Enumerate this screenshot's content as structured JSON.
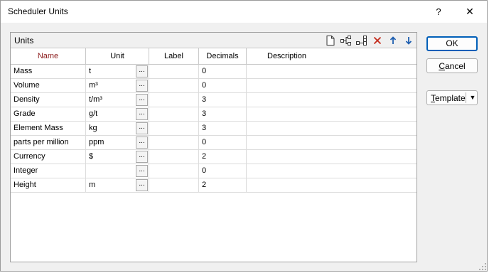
{
  "window": {
    "title": "Scheduler Units",
    "help_label": "?",
    "close_label": "✕"
  },
  "panel": {
    "title": "Units",
    "toolbar_icons": [
      "new-document-icon",
      "insert-row-icon",
      "append-row-icon",
      "delete-icon",
      "move-up-icon",
      "move-down-icon"
    ]
  },
  "table": {
    "columns": [
      "Name",
      "Unit",
      "Label",
      "Decimals",
      "Description"
    ],
    "rows": [
      {
        "name": "Mass",
        "unit": "t",
        "label": "",
        "decimals": "0",
        "description": ""
      },
      {
        "name": "Volume",
        "unit": "m³",
        "label": "",
        "decimals": "0",
        "description": ""
      },
      {
        "name": "Density",
        "unit": "t/m³",
        "label": "",
        "decimals": "3",
        "description": ""
      },
      {
        "name": "Grade",
        "unit": "g/t",
        "label": "",
        "decimals": "3",
        "description": ""
      },
      {
        "name": "Element Mass",
        "unit": "kg",
        "label": "",
        "decimals": "3",
        "description": ""
      },
      {
        "name": "parts per million",
        "unit": "ppm",
        "label": "",
        "decimals": "0",
        "description": ""
      },
      {
        "name": "Currency",
        "unit": "$",
        "label": "",
        "decimals": "2",
        "description": ""
      },
      {
        "name": "Integer",
        "unit": "",
        "label": "",
        "decimals": "0",
        "description": ""
      },
      {
        "name": "Height",
        "unit": "m",
        "label": "",
        "decimals": "2",
        "description": ""
      }
    ],
    "ellipsis_label": "..."
  },
  "buttons": {
    "ok": "OK",
    "cancel_first": "C",
    "cancel_rest": "ancel",
    "template_first": "T",
    "template_rest": "emplate",
    "template_arrow": "▼"
  },
  "colors": {
    "accent": "#005fb8",
    "name_header": "#8b1a1a",
    "delete": "#c42b1c",
    "arrow": "#1f5fb0"
  }
}
